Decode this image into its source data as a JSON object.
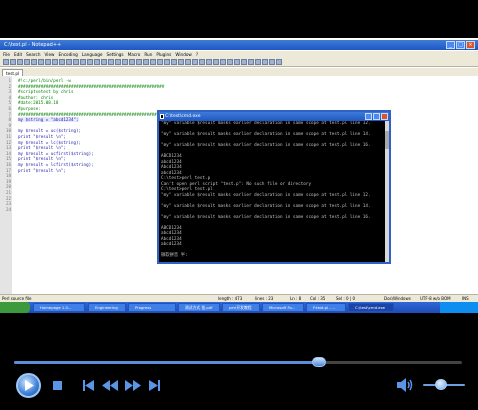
{
  "editor": {
    "title": "C:\\test.pl - Notepad++",
    "menu": [
      "File",
      "Edit",
      "Search",
      "View",
      "Encoding",
      "Language",
      "Settings",
      "Macro",
      "Run",
      "Plugins",
      "Window",
      "?"
    ],
    "tab": "test.pl",
    "lines": [
      {
        "n": "1",
        "text": "#!c:/perl/bin/perl -w",
        "cls": "c-comment"
      },
      {
        "n": "2",
        "text": "##########################################################",
        "cls": "c-comment"
      },
      {
        "n": "3",
        "text": "#scriptsetest by chris",
        "cls": "c-comment"
      },
      {
        "n": "4",
        "text": "#author: chris",
        "cls": "c-comment"
      },
      {
        "n": "5",
        "text": "#date:2015.08.18",
        "cls": "c-comment"
      },
      {
        "n": "6",
        "text": "#purpose:",
        "cls": "c-comment"
      },
      {
        "n": "7",
        "text": "##########################################################",
        "cls": "c-comment"
      },
      {
        "n": "8",
        "text": "my $string = \"abcd1234\";",
        "cls": "c-code hl"
      },
      {
        "n": "9",
        "text": "",
        "cls": "c-code"
      },
      {
        "n": "10",
        "text": "my $result = uc($string);",
        "cls": "c-code"
      },
      {
        "n": "11",
        "text": "print \"$result \\n\";",
        "cls": "c-code"
      },
      {
        "n": "12",
        "text": "my $result = lc($string);",
        "cls": "c-code"
      },
      {
        "n": "13",
        "text": "print \"$result \\n\";",
        "cls": "c-code"
      },
      {
        "n": "14",
        "text": "my $result = ucfirst($string);",
        "cls": "c-code"
      },
      {
        "n": "15",
        "text": "print \"$result \\n\";",
        "cls": "c-code"
      },
      {
        "n": "16",
        "text": "my $result = lcfirst($string);",
        "cls": "c-code"
      },
      {
        "n": "17",
        "text": "print \"$result \\n\";",
        "cls": "c-code"
      },
      {
        "n": "18",
        "text": "",
        "cls": "c-code"
      },
      {
        "n": "19",
        "text": "",
        "cls": "c-code"
      },
      {
        "n": "20",
        "text": "",
        "cls": "c-code"
      },
      {
        "n": "21",
        "text": "",
        "cls": "c-code"
      },
      {
        "n": "22",
        "text": "",
        "cls": "c-code"
      },
      {
        "n": "23",
        "text": "",
        "cls": "c-code"
      },
      {
        "n": "24",
        "text": "",
        "cls": "c-code"
      }
    ],
    "status": {
      "filetype": "Perl source file",
      "length": "length : 473",
      "lines": "lines : 23",
      "ln": "Ln : 8",
      "col": "Col : 35",
      "sel": "Sel : 0 | 0",
      "eol": "Dos\\Windows",
      "enc": "UTF-8 w/o BOM",
      "ins": "INS"
    }
  },
  "cmd": {
    "title": "C:\\test\\cmd.exe",
    "lines": [
      "\"my\" variable $result masks earlier declaration in same scope at test.pl line 12.",
      "",
      "\"my\" variable $result masks earlier declaration in same scope at test.pl line 14.",
      "",
      "\"my\" variable $result masks earlier declaration in same scope at test.pl line 16.",
      "",
      "ABCD1234",
      "abcd1234",
      "Abcd1234",
      "abcd1234",
      "C:\\test>perl test.p",
      "Can't open perl script \"test.p\": No such file or directory",
      "C:\\test>perl test.pl",
      "\"my\" variable $result masks earlier declaration in same scope at test.pl line 12.",
      "",
      "\"my\" variable $result masks earlier declaration in same scope at test.pl line 14.",
      "",
      "\"my\" variable $result masks earlier declaration in same scope at test.pl line 16.",
      "",
      "ABCD1234",
      "abcd1234",
      "Abcd1234",
      "abcd1234",
      "",
      "微软拼音 半:"
    ]
  },
  "taskbar": {
    "items": [
      "Homepage 1.0...",
      "Engineering",
      "Progress",
      "测试方式 批.pdf",
      "perl开发教程",
      "Microsoft Fo...",
      "F:test.pl - ...",
      "C:\\test\\cmd.exe"
    ]
  },
  "player": {
    "progress": 0.68,
    "volume": 0.42,
    "icons": [
      "play-icon",
      "stop-icon",
      "previous-icon",
      "rewind-icon",
      "fast-forward-icon",
      "next-icon",
      "volume-icon"
    ]
  }
}
